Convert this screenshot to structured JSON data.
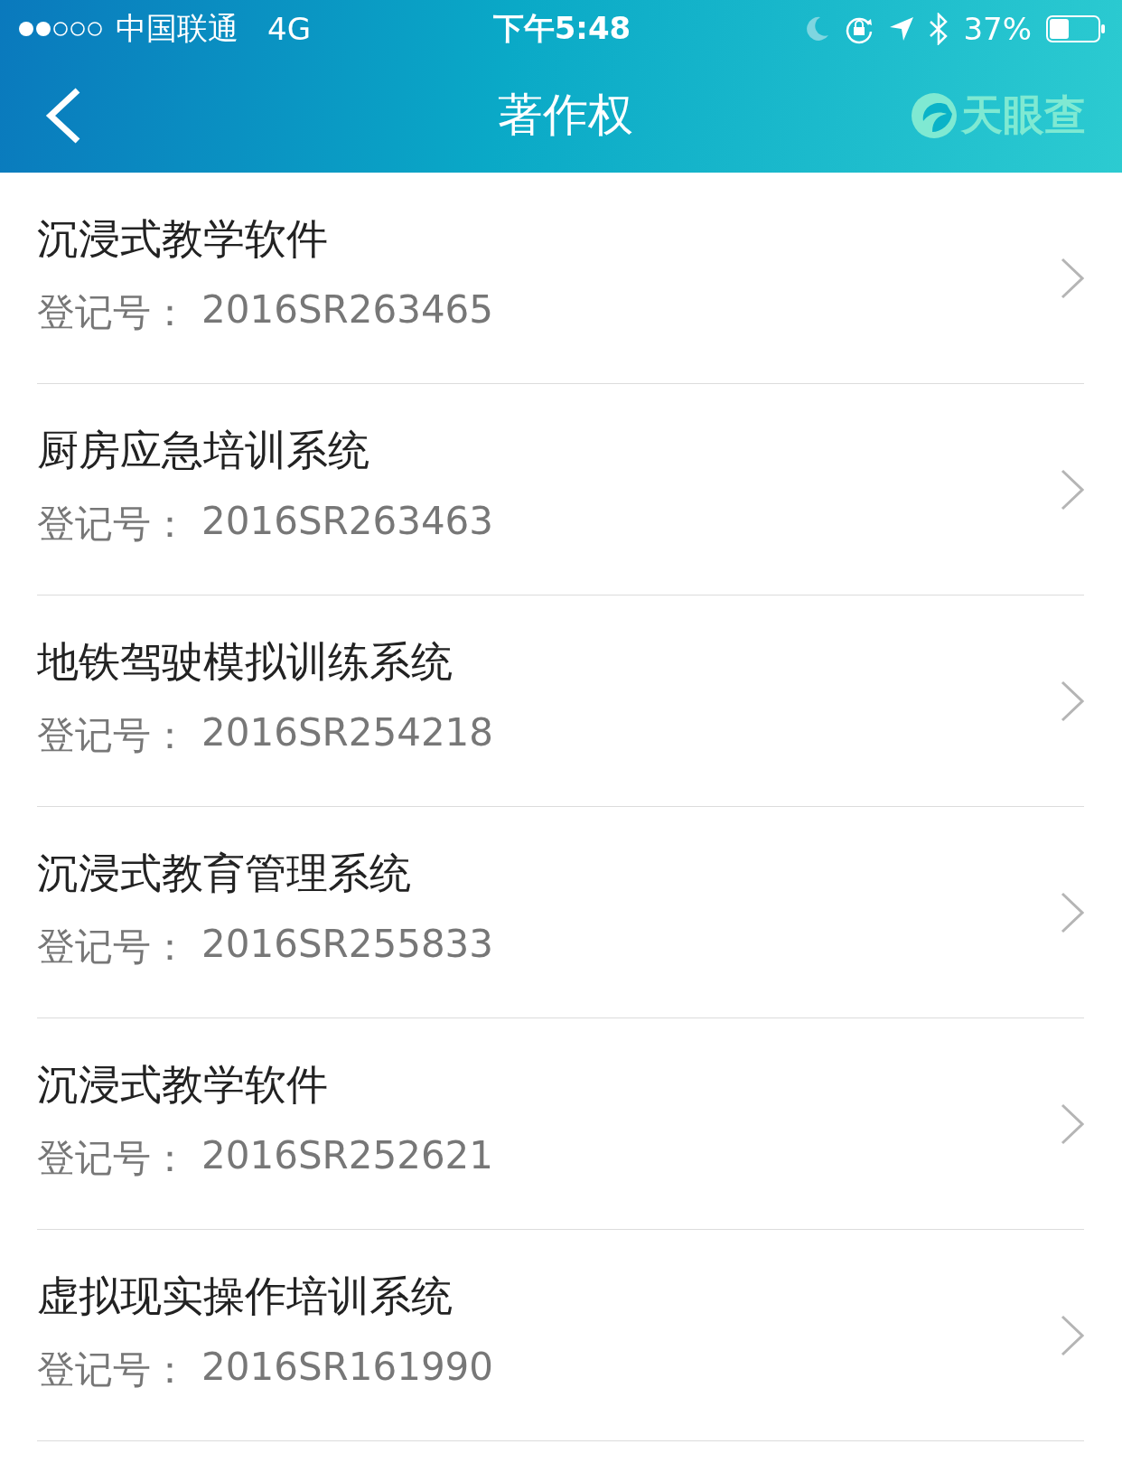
{
  "status_bar": {
    "carrier": "中国联通",
    "network": "4G",
    "time": "下午5:48",
    "battery": "37%"
  },
  "nav": {
    "title": "著作权",
    "brand": "天眼查"
  },
  "items": [
    {
      "title": "沉浸式教学软件",
      "label": "登记号：",
      "reg_no": "2016SR263465"
    },
    {
      "title": "厨房应急培训系统",
      "label": "登记号：",
      "reg_no": "2016SR263463"
    },
    {
      "title": "地铁驾驶模拟训练系统",
      "label": "登记号：",
      "reg_no": "2016SR254218"
    },
    {
      "title": "沉浸式教育管理系统",
      "label": "登记号：",
      "reg_no": "2016SR255833"
    },
    {
      "title": "沉浸式教学软件",
      "label": "登记号：",
      "reg_no": "2016SR252621"
    },
    {
      "title": "虚拟现实操作培训系统",
      "label": "登记号：",
      "reg_no": "2016SR161990"
    }
  ]
}
